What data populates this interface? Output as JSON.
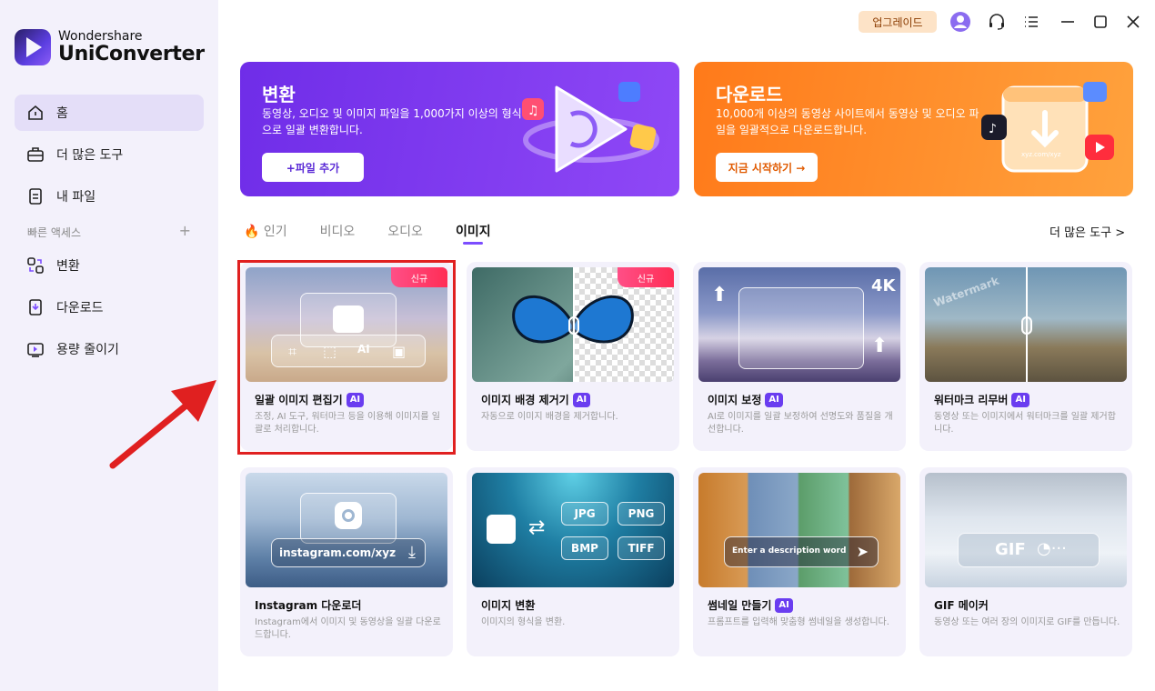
{
  "app": {
    "brand_line1": "Wondershare",
    "brand_line2": "UniConverter"
  },
  "sidebar": {
    "items": [
      {
        "label": "홈",
        "icon": "home-icon"
      },
      {
        "label": "더 많은 도구",
        "icon": "toolbox-icon"
      },
      {
        "label": "내 파일",
        "icon": "file-icon"
      }
    ],
    "quick_access_label": "빠른 액세스",
    "quick_items": [
      {
        "label": "변환",
        "icon": "convert-icon"
      },
      {
        "label": "다운로드",
        "icon": "download-icon"
      },
      {
        "label": "용량 줄이기",
        "icon": "compress-icon"
      }
    ]
  },
  "topbar": {
    "upgrade_label": "업그레이드"
  },
  "banners": {
    "convert": {
      "title": "변환",
      "desc": "동영상, 오디오 및 이미지 파일을 1,000가지 이상의 형식으로 일괄 변환합니다.",
      "button": "+파일 추가"
    },
    "download": {
      "title": "다운로드",
      "desc": "10,000개 이상의 동영상 사이트에서 동영상 및 오디오 파일을 일괄적으로 다운로드합니다.",
      "button": "지금 시작하기 →",
      "url_hint": "xyz.com/xyz"
    }
  },
  "tabs": [
    "인기",
    "비디오",
    "오디오",
    "이미지"
  ],
  "active_tab": "이미지",
  "more_tools": "더 많은 도구 >",
  "cards": [
    {
      "title": "일괄 이미지 편집기",
      "ai": "AI",
      "badge": "신규",
      "desc": "조정, AI 도구, 워터마크 등을 이용해 이미지를 일괄로 처리합니다."
    },
    {
      "title": "이미지 배경 제거기",
      "ai": "AI",
      "badge": "신규",
      "desc": "자동으로 이미지 배경을 제거합니다."
    },
    {
      "title": "이미지 보정",
      "ai": "AI",
      "desc": "AI로 이미지를 일괄 보정하여 선명도와 품질을 개선합니다.",
      "badge_text": "4K"
    },
    {
      "title": "워터마크 리무버",
      "ai": "AI",
      "desc": "동영상 또는 이미지에서 워터마크를 일괄 제거합니다.",
      "watermark": "Watermark"
    },
    {
      "title": "Instagram 다운로더",
      "desc": "Instagram에서 이미지 및 동영상을 일괄 다운로드합니다.",
      "url": "instagram.com/xyz"
    },
    {
      "title": "이미지 변환",
      "desc": "이미지의 형식을 변환.",
      "formats": [
        "JPG",
        "PNG",
        "BMP",
        "TIFF"
      ]
    },
    {
      "title": "썸네일 만들기",
      "ai": "AI",
      "desc": "프롬프트를 입력해 맞춤형 썸네일을 생성합니다.",
      "prompt": "Enter a description word"
    },
    {
      "title": "GIF 메이커",
      "desc": "동영상 또는 여러 장의 이미지로 GIF를 만듭니다.",
      "gif_label": "GIF"
    }
  ],
  "colors": {
    "accent": "#7c4dff",
    "convert_banner": "#7b3ff2",
    "download_banner": "#ff8a1f",
    "highlight": "#e02020"
  }
}
